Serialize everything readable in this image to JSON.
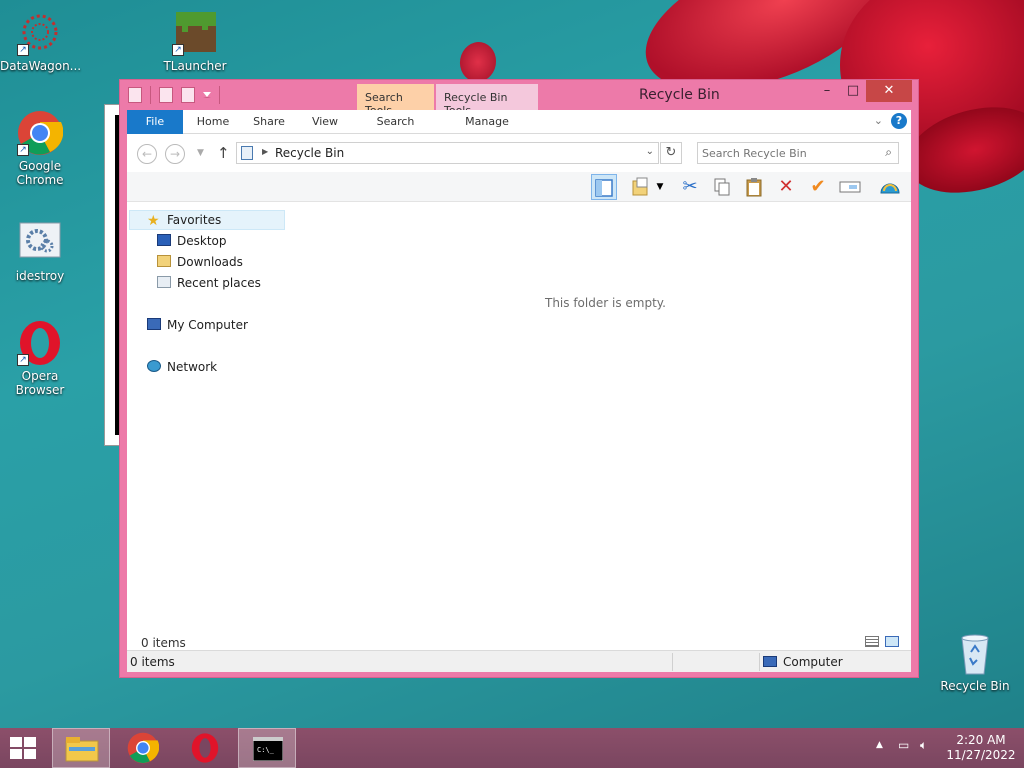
{
  "desktop": {
    "icons": [
      {
        "label": "DataWagon...",
        "icon": "datawagon-icon"
      },
      {
        "label": "TLauncher",
        "icon": "tlauncher-icon"
      },
      {
        "label": "Google Chrome",
        "icon": "chrome-icon"
      },
      {
        "label": "idestroy",
        "icon": "idestroy-icon"
      },
      {
        "label": "Opera Browser",
        "icon": "opera-icon"
      },
      {
        "label": "Recycle Bin",
        "icon": "recycle-bin-icon"
      }
    ]
  },
  "window": {
    "title": "Recycle Bin",
    "context_tabs": {
      "search_tools": "Search Tools",
      "recycle_bin_tools": "Recycle Bin Tools"
    },
    "ribbon_tabs": [
      "File",
      "Home",
      "Share",
      "View",
      "Search",
      "Manage"
    ],
    "help": "?",
    "address": {
      "path": "Recycle Bin"
    },
    "search": {
      "placeholder": "Search Recycle Bin"
    },
    "nav": {
      "favorites": "Favorites",
      "desktop": "Desktop",
      "downloads": "Downloads",
      "recent": "Recent places",
      "computer": "My Computer",
      "network": "Network"
    },
    "empty_message": "This folder is empty.",
    "item_count_content": "0 items",
    "status": {
      "left": "0 items",
      "right": "Computer"
    }
  },
  "taskbar": {
    "time": "2:20 AM",
    "date": "11/27/2022"
  },
  "colors": {
    "window_frame": "#ed7aa9",
    "close_button": "#c74747",
    "file_tab": "#1979ca",
    "taskbar": "#7a4660"
  }
}
